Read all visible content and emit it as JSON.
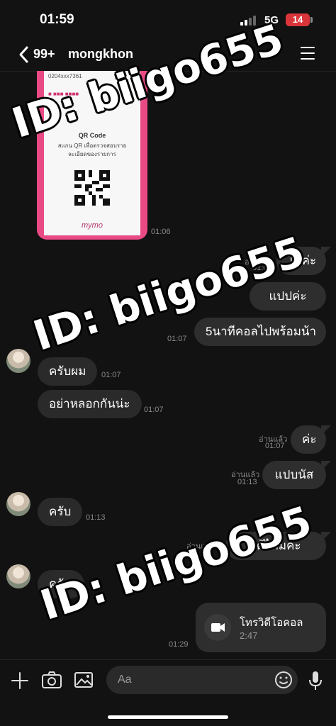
{
  "status_bar": {
    "time": "01:59",
    "network": "5G",
    "battery": "14"
  },
  "header": {
    "unread_count": "99+",
    "contact_name": "mongkhon"
  },
  "receipt_image": {
    "account": "0204xxx7361",
    "qr_title": "QR Code",
    "qr_description": "สแกน QR เพื่อตรวจสอบรายละเอียดของรายการ",
    "logo": "mymo",
    "time": "01:06"
  },
  "messages_out_top": [
    {
      "text": "ได้ค่ะ",
      "read": "อ่านแล้ว",
      "time": "01:07"
    },
    {
      "text": "แปปค่ะ"
    },
    {
      "text": "5นาทีคอลไปพร้อมน้า",
      "time": "01:07"
    }
  ],
  "messages_in_1": [
    {
      "text": "ครับผม",
      "time": "01:07"
    },
    {
      "text": "อย่าหลอกกันน่ะ",
      "time": "01:07"
    }
  ],
  "messages_out_mid": [
    {
      "text": "ค่ะ",
      "read": "อ่านแล้ว",
      "time": "01:07"
    },
    {
      "text": "แปบนัส",
      "read": "อ่านแล้ว",
      "time": "01:13"
    }
  ],
  "messages_in_2": [
    {
      "text": "ครับ",
      "time": "01:13"
    }
  ],
  "messages_out_3": [
    {
      "text": "ได้ไหมคะ",
      "read": "อ่านแล้ว"
    }
  ],
  "messages_in_3": [
    {
      "text": "ครับ"
    }
  ],
  "video_call": {
    "label": "โทรวิดีโอคอล",
    "duration": "2:47",
    "time": "01:29"
  },
  "input_bar": {
    "placeholder": "Aa"
  },
  "watermark": {
    "text": "ID: biigo655"
  },
  "icons": [
    "back-chevron-icon",
    "menu-icon",
    "plus-icon",
    "camera-icon",
    "image-icon",
    "emoji-icon",
    "microphone-icon",
    "video-camera-icon"
  ]
}
